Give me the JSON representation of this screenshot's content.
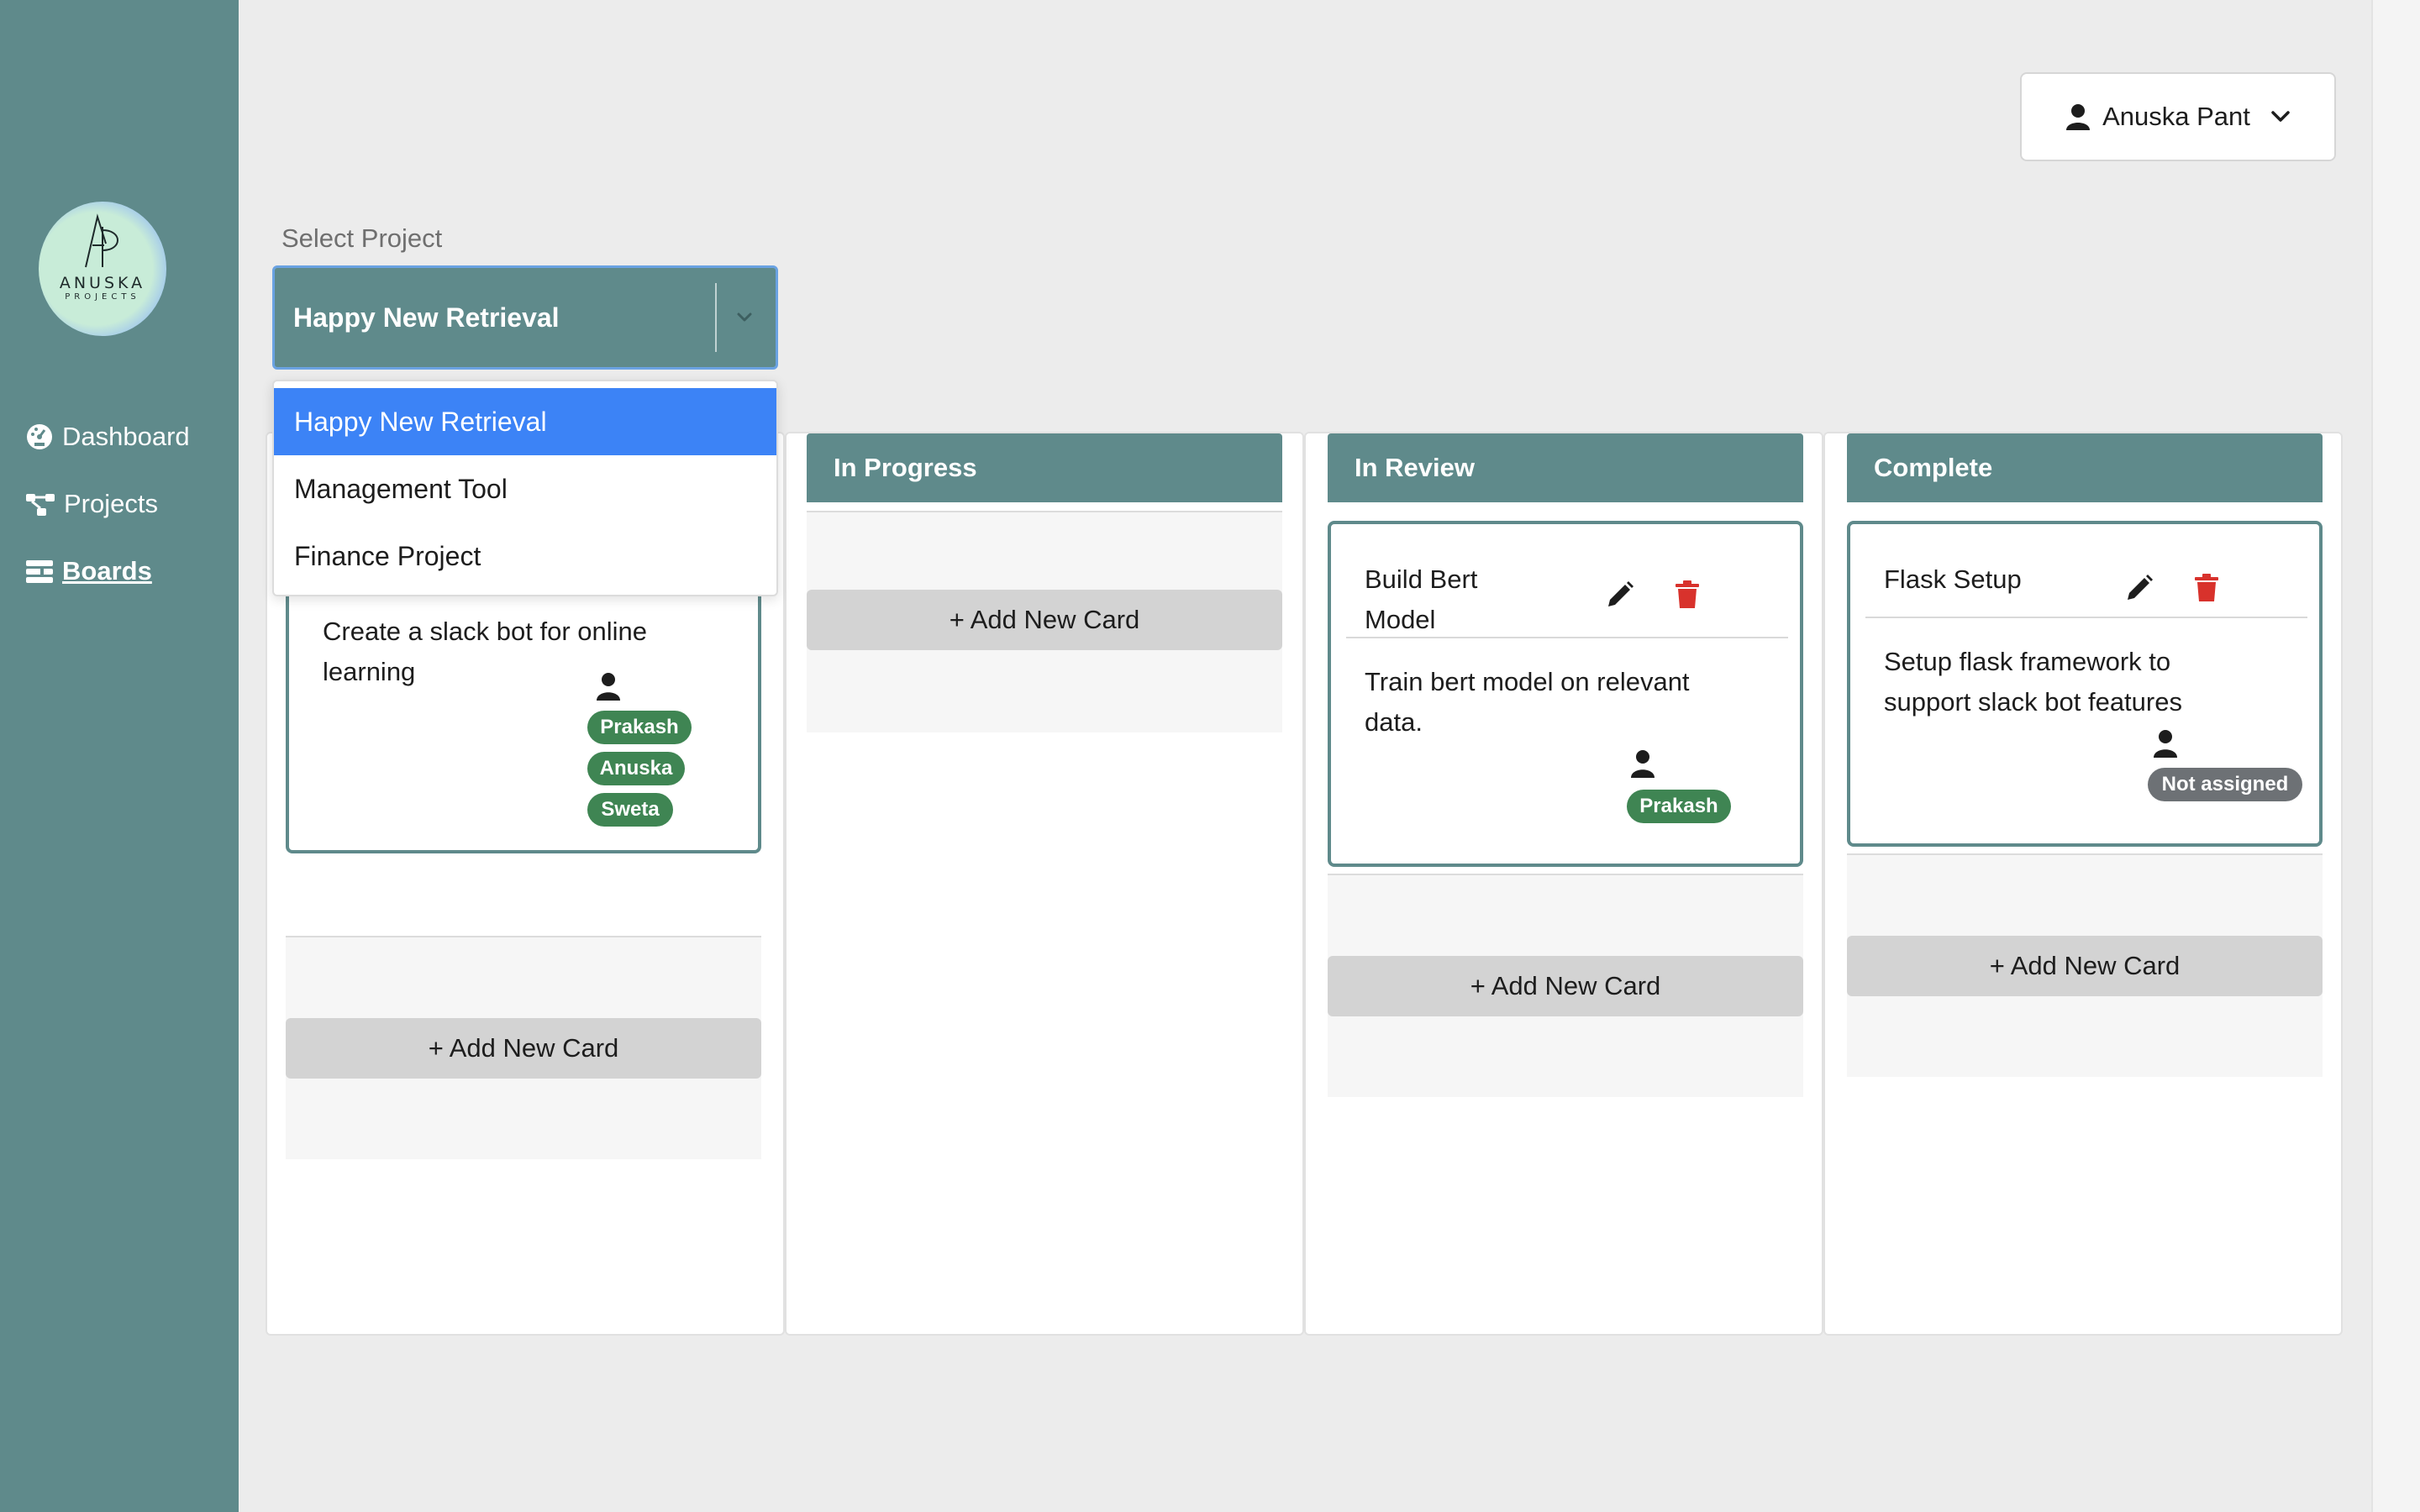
{
  "sidebar": {
    "logo": {
      "name": "ANUSKA",
      "sub": "PROJECTS"
    },
    "items": [
      {
        "label": "Dashboard",
        "icon": "dashboard-icon"
      },
      {
        "label": "Projects",
        "icon": "sitemap-icon"
      },
      {
        "label": " Boards",
        "icon": "boards-icon",
        "active": true
      }
    ]
  },
  "header": {
    "user_name": "Anuska Pant"
  },
  "project_select": {
    "label": "Select Project",
    "value": "Happy New Retrieval",
    "options": [
      "Happy New Retrieval",
      "Management Tool",
      "Finance Project"
    ]
  },
  "columns": [
    {
      "title": "",
      "add_label": "+ Add New Card",
      "cards": [
        {
          "title": "",
          "description_lines": [
            "Create a slack bot for online",
            "learning"
          ],
          "assignees": [
            "Prakash",
            "Anuska",
            "Sweta"
          ]
        }
      ]
    },
    {
      "title": "In Progress",
      "add_label": "+ Add New Card",
      "cards": []
    },
    {
      "title": "In Review",
      "add_label": "+ Add New Card",
      "cards": [
        {
          "title_lines": [
            "Build Bert",
            "Model"
          ],
          "description_lines": [
            "Train bert model on relevant",
            "data."
          ],
          "assignees": [
            "Prakash"
          ]
        }
      ]
    },
    {
      "title": "Complete",
      "add_label": "+ Add New Card",
      "cards": [
        {
          "title": "Flask Setup",
          "description_lines": [
            "Setup flask framework to",
            "support slack bot features"
          ],
          "assignees": [
            "Not assigned"
          ]
        }
      ]
    }
  ],
  "colors": {
    "sidebar": "#5f8a8b",
    "header": "#5f8a8b",
    "badge": "#3f8553",
    "badge_unassigned": "#6d7175",
    "delete": "#d8322c",
    "selected_option": "#3c83f6"
  }
}
